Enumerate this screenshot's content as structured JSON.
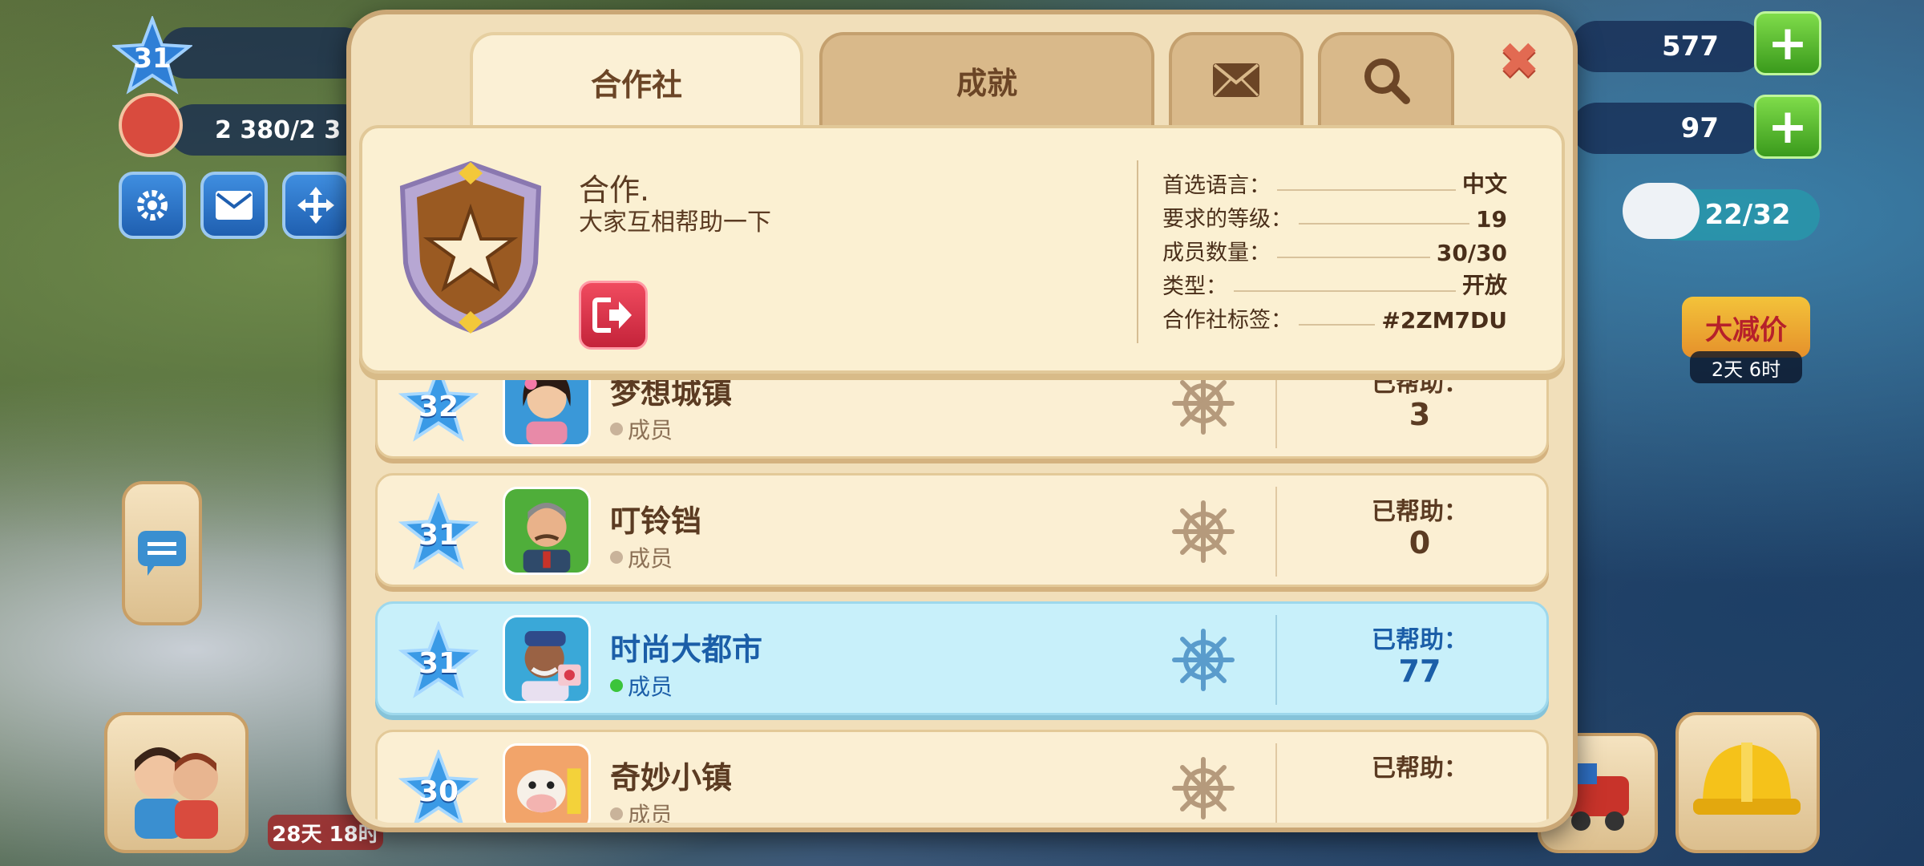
{
  "hud": {
    "level": "31",
    "population": "2 380/2 3",
    "coins": "577",
    "cash": "97",
    "cloud_capacity": "22/32",
    "sale_label": "大减价",
    "sale_timer": "2天 6时",
    "bottom_timer": "28天 18时"
  },
  "tabs": [
    {
      "label": "合作社",
      "active": true
    },
    {
      "label": "成就",
      "active": false
    },
    {
      "icon": "mail-icon"
    },
    {
      "icon": "search-icon"
    }
  ],
  "close_icon": "close-icon",
  "coop": {
    "name": "合作.",
    "description": "大家互相帮助一下",
    "stats": [
      {
        "label": "首选语言：",
        "value": "中文"
      },
      {
        "label": "要求的等级：",
        "value": "19"
      },
      {
        "label": "成员数量：",
        "value": "30/30"
      },
      {
        "label": "类型：",
        "value": "开放"
      },
      {
        "label": "合作社标签：",
        "value": "#2ZM7DU"
      }
    ]
  },
  "members": [
    {
      "level": "32",
      "name": "梦想城镇",
      "role": "成员",
      "helped_label": "已帮助：",
      "helped": "3",
      "highlight": false
    },
    {
      "level": "31",
      "name": "叮铃铛",
      "role": "成员",
      "helped_label": "已帮助：",
      "helped": "0",
      "highlight": false
    },
    {
      "level": "31",
      "name": "时尚大都市",
      "role": "成员",
      "helped_label": "已帮助：",
      "helped": "77",
      "highlight": true
    },
    {
      "level": "30",
      "name": "奇妙小镇",
      "role": "成员",
      "helped_label": "已帮助：",
      "helped": "",
      "highlight": false
    }
  ],
  "colors": {
    "dialog_bg": "#f1dfba",
    "highlight_row": "#c8f0fa",
    "leave_button": "#e03a4e",
    "level_star": "#3a8fe0"
  }
}
